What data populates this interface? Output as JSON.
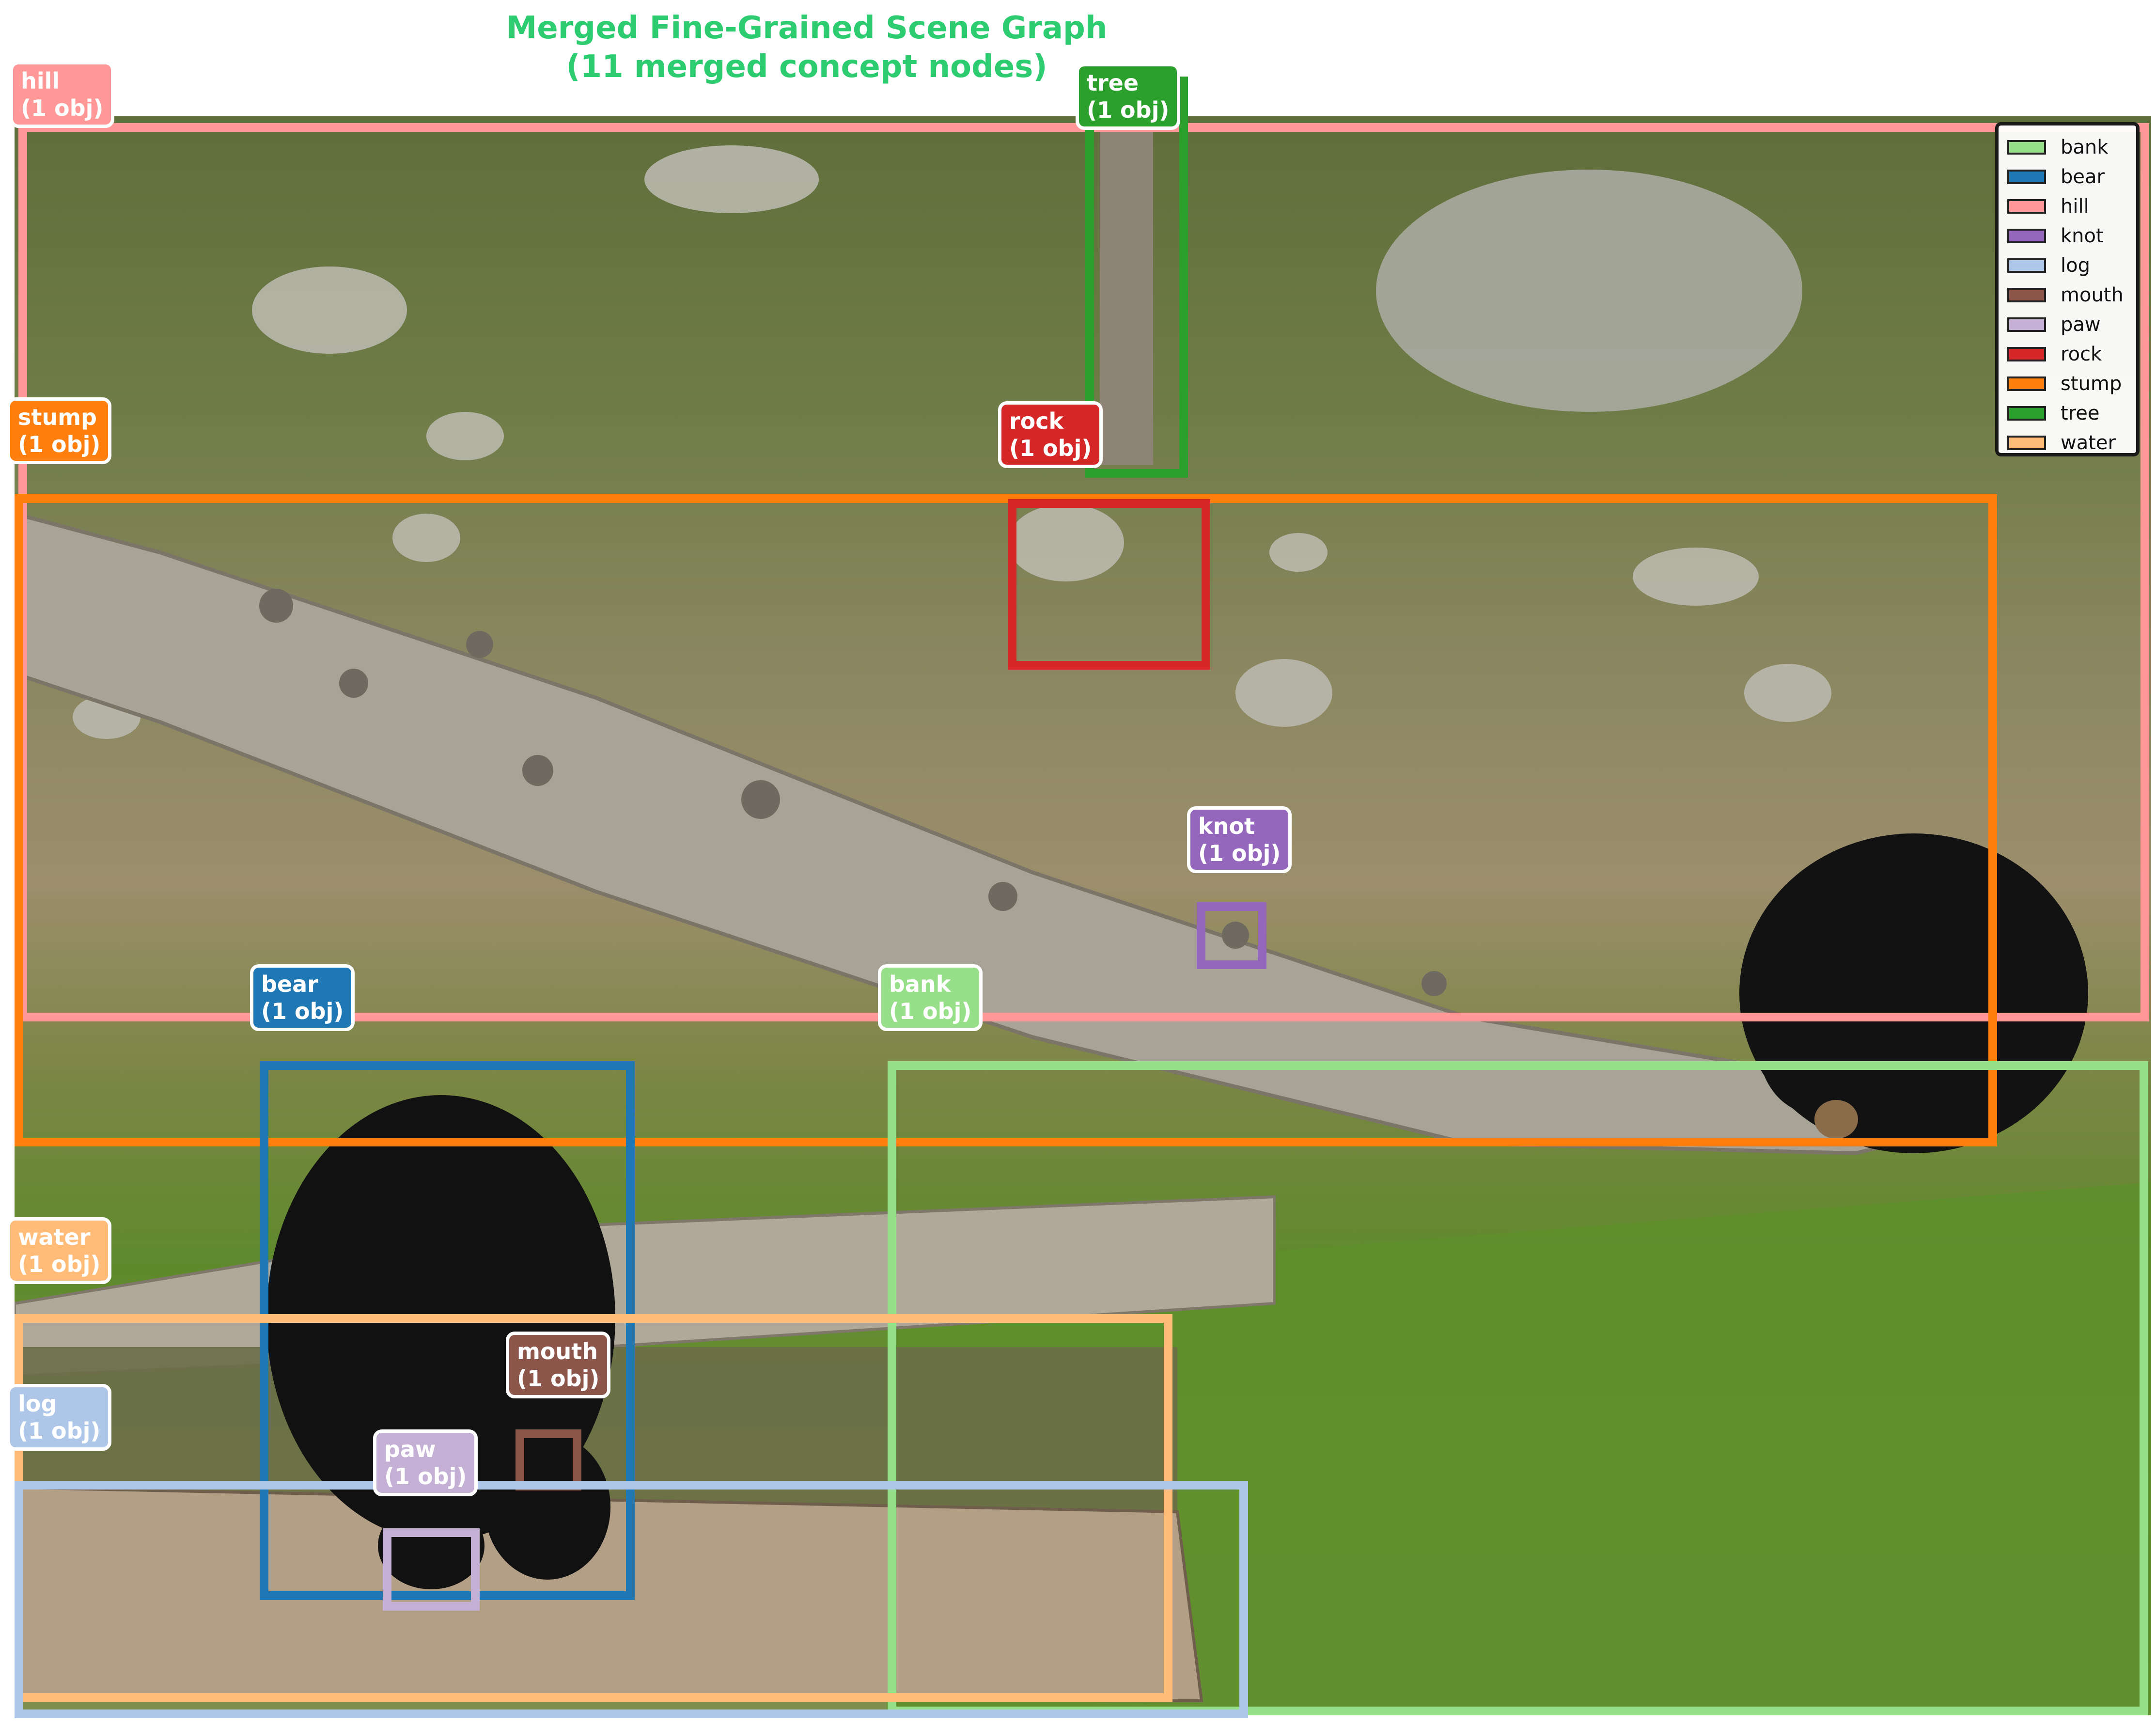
{
  "title": {
    "line1": "Merged Fine-Grained Scene Graph",
    "line2": "(11 merged concept nodes)",
    "color": "#2ecc71"
  },
  "nodes": {
    "hill": {
      "name": "hill",
      "count": "(1 obj)",
      "color": "#ff9896"
    },
    "tree": {
      "name": "tree",
      "count": "(1 obj)",
      "color": "#2ca02c"
    },
    "stump": {
      "name": "stump",
      "count": "(1 obj)",
      "color": "#ff7f0e"
    },
    "rock": {
      "name": "rock",
      "count": "(1 obj)",
      "color": "#d62728"
    },
    "knot": {
      "name": "knot",
      "count": "(1 obj)",
      "color": "#9467bd"
    },
    "bear": {
      "name": "bear",
      "count": "(1 obj)",
      "color": "#1f77b4"
    },
    "bank": {
      "name": "bank",
      "count": "(1 obj)",
      "color": "#98df8a"
    },
    "water": {
      "name": "water",
      "count": "(1 obj)",
      "color": "#ffbb78"
    },
    "mouth": {
      "name": "mouth",
      "count": "(1 obj)",
      "color": "#8c564b"
    },
    "log": {
      "name": "log",
      "count": "(1 obj)",
      "color": "#aec7e8"
    },
    "paw": {
      "name": "paw",
      "count": "(1 obj)",
      "color": "#c5b0d5"
    }
  },
  "legend": [
    {
      "label": "bank",
      "color": "#98df8a"
    },
    {
      "label": "bear",
      "color": "#1f77b4"
    },
    {
      "label": "hill",
      "color": "#ff9896"
    },
    {
      "label": "knot",
      "color": "#9467bd"
    },
    {
      "label": "log",
      "color": "#aec7e8"
    },
    {
      "label": "mouth",
      "color": "#8c564b"
    },
    {
      "label": "paw",
      "color": "#c5b0d5"
    },
    {
      "label": "rock",
      "color": "#d62728"
    },
    {
      "label": "stump",
      "color": "#ff7f0e"
    },
    {
      "label": "tree",
      "color": "#2ca02c"
    },
    {
      "label": "water",
      "color": "#ffbb78"
    }
  ]
}
